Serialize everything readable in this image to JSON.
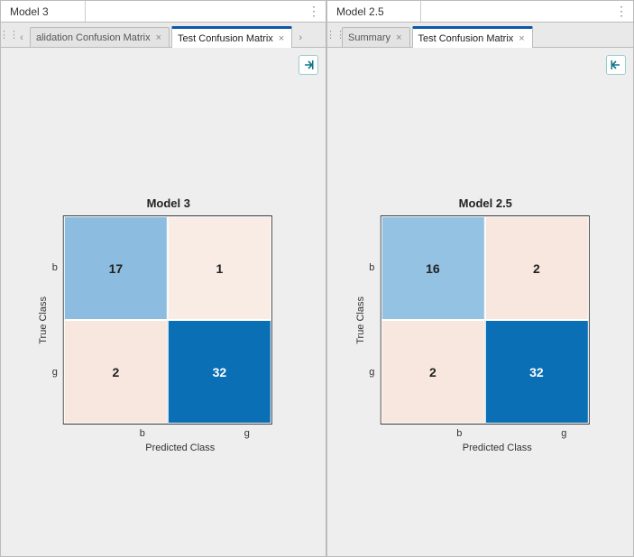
{
  "left": {
    "model_title": "Model 3",
    "tabs": [
      {
        "label": "alidation Confusion Matrix",
        "active": false
      },
      {
        "label": "Test Confusion Matrix",
        "active": true
      }
    ],
    "chart": {
      "title": "Model 3",
      "ylabel": "True Class",
      "xlabel": "Predicted Class",
      "classes": [
        "b",
        "g"
      ],
      "cells": [
        {
          "value": 17,
          "color": "#8cbde0",
          "tone": "mid"
        },
        {
          "value": 1,
          "color": "#f9ece5",
          "tone": "light"
        },
        {
          "value": 2,
          "color": "#f8e7de",
          "tone": "light"
        },
        {
          "value": 32,
          "color": "#0b6fb5",
          "tone": "dark"
        }
      ]
    }
  },
  "right": {
    "model_title": "Model 2.5",
    "tabs": [
      {
        "label": "Summary",
        "active": false
      },
      {
        "label": "Test Confusion Matrix",
        "active": true
      }
    ],
    "chart": {
      "title": "Model 2.5",
      "ylabel": "True Class",
      "xlabel": "Predicted Class",
      "classes": [
        "b",
        "g"
      ],
      "cells": [
        {
          "value": 16,
          "color": "#93c2e2",
          "tone": "mid"
        },
        {
          "value": 2,
          "color": "#f8e7de",
          "tone": "light"
        },
        {
          "value": 2,
          "color": "#f8e7de",
          "tone": "light"
        },
        {
          "value": 32,
          "color": "#0b6fb5",
          "tone": "dark"
        }
      ]
    }
  },
  "chart_data": [
    {
      "type": "heatmap",
      "title": "Model 3",
      "xlabel": "Predicted Class",
      "ylabel": "True Class",
      "x_categories": [
        "b",
        "g"
      ],
      "y_categories": [
        "b",
        "g"
      ],
      "values": [
        [
          17,
          1
        ],
        [
          2,
          32
        ]
      ]
    },
    {
      "type": "heatmap",
      "title": "Model 2.5",
      "xlabel": "Predicted Class",
      "ylabel": "True Class",
      "x_categories": [
        "b",
        "g"
      ],
      "y_categories": [
        "b",
        "g"
      ],
      "values": [
        [
          16,
          2
        ],
        [
          2,
          32
        ]
      ]
    }
  ]
}
